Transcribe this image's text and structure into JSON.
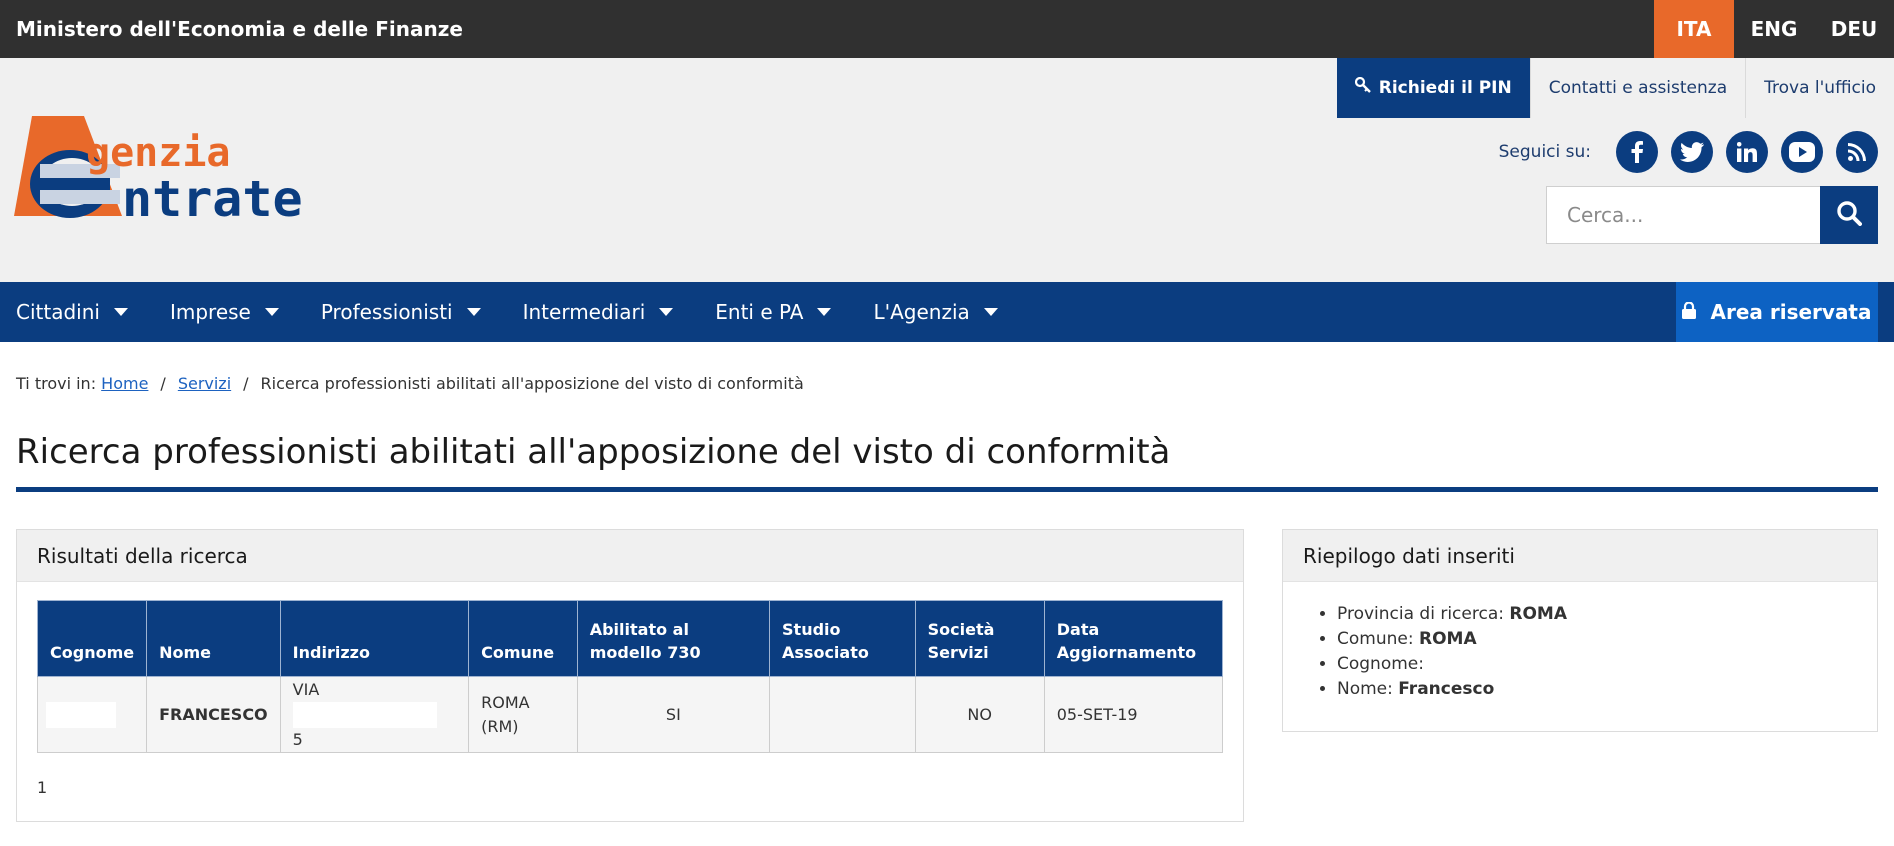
{
  "topbar": {
    "ministry": "Ministero dell'Economia e delle Finanze",
    "languages": [
      {
        "label": "ITA",
        "active": true
      },
      {
        "label": "ENG",
        "active": false
      },
      {
        "label": "DEU",
        "active": false
      }
    ]
  },
  "header": {
    "logo": {
      "line1": "genzia",
      "line2": "ntrate",
      "icon": "agenzia-entrate-logo"
    },
    "links": {
      "pin": "Richiedi il PIN",
      "contacts": "Contatti e assistenza",
      "office": "Trova l'ufficio"
    },
    "social_label": "Seguici su:",
    "social": [
      "facebook-icon",
      "twitter-icon",
      "linkedin-icon",
      "youtube-icon",
      "rss-icon"
    ],
    "search_placeholder": "Cerca..."
  },
  "nav": {
    "items": [
      "Cittadini",
      "Imprese",
      "Professionisti",
      "Intermediari",
      "Enti e PA",
      "L'Agenzia"
    ],
    "area": "Area riservata"
  },
  "breadcrumb": {
    "prefix": "Ti trovi in:",
    "home": "Home",
    "servizi": "Servizi",
    "current": "Ricerca professionisti abilitati all'apposizione del visto di conformità"
  },
  "page_title": "Ricerca professionisti abilitati all'apposizione del visto di conformità",
  "results": {
    "title": "Risultati della ricerca",
    "columns": [
      "Cognome",
      "Nome",
      "Indirizzo",
      "Comune",
      "Abilitato al modello 730",
      "Studio Associato",
      "Società Servizi",
      "Data Aggiornamento"
    ],
    "row": {
      "nome": "FRANCESCO",
      "indirizzo_prefix": "VIA",
      "indirizzo_num": "5",
      "comune_line1": "ROMA",
      "comune_line2": "(RM)",
      "abilitato": "SI",
      "studio": "",
      "societa": "NO",
      "data": "05-SET-19"
    },
    "page": "1"
  },
  "summary": {
    "title": "Riepilogo dati inseriti",
    "items": [
      {
        "label": "Provincia di ricerca:",
        "value": "ROMA"
      },
      {
        "label": "Comune:",
        "value": "ROMA"
      },
      {
        "label": "Cognome:",
        "value": ""
      },
      {
        "label": "Nome:",
        "value": "Francesco"
      }
    ]
  },
  "colors": {
    "dark_bar": "#303030",
    "accent_orange": "#e8692a",
    "brand_blue": "#0b3d80",
    "area_blue": "#0d62c3"
  }
}
